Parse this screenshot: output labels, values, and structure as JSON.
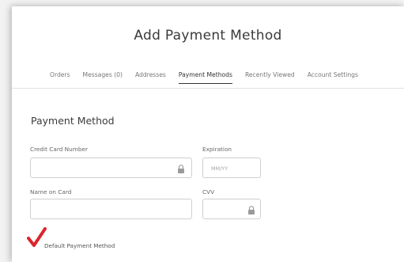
{
  "page": {
    "title": "Add Payment Method"
  },
  "tabs": [
    {
      "label": "Orders",
      "active": false
    },
    {
      "label": "Messages (0)",
      "active": false
    },
    {
      "label": "Addresses",
      "active": false
    },
    {
      "label": "Payment Methods",
      "active": true
    },
    {
      "label": "Recently Viewed",
      "active": false
    },
    {
      "label": "Account Settings",
      "active": false
    }
  ],
  "form": {
    "section_title": "Payment Method",
    "card_number": {
      "label": "Credit Card Number",
      "value": "",
      "placeholder": ""
    },
    "expiration": {
      "label": "Expiration",
      "value": "",
      "placeholder": "MM/YY"
    },
    "name_on_card": {
      "label": "Name on Card",
      "value": "",
      "placeholder": ""
    },
    "cvv": {
      "label": "CVV",
      "value": "",
      "placeholder": ""
    },
    "default_checkbox": {
      "label": "Default Payment Method",
      "checked": true
    }
  },
  "icons": {
    "card_number_lock": "lock-icon",
    "cvv_lock": "lock-icon",
    "default_check": "checkmark-icon"
  },
  "colors": {
    "check": "#d9262c",
    "border": "#cfcfcf",
    "background": "#f2f2f2"
  }
}
